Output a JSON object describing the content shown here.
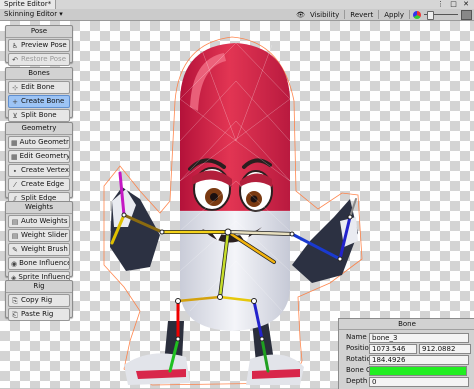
{
  "window": {
    "title": "Sprite Editor*",
    "controls": "⋮ □ ✕"
  },
  "toolbar": {
    "mode": "Skinning Editor ▾",
    "visibility": "Visibility",
    "revert": "Revert",
    "apply": "Apply"
  },
  "panels": {
    "pose": {
      "title": "Pose",
      "items": [
        {
          "label": "Preview Pose",
          "icon": "♿"
        },
        {
          "label": "Restore Pose",
          "icon": "↶"
        }
      ]
    },
    "bones": {
      "title": "Bones",
      "items": [
        {
          "label": "Edit Bone",
          "icon": "⊹"
        },
        {
          "label": "Create Bone",
          "icon": "+"
        },
        {
          "label": "Split Bone",
          "icon": "⊻"
        }
      ]
    },
    "geometry": {
      "title": "Geometry",
      "items": [
        {
          "label": "Auto Geometry",
          "icon": "▦"
        },
        {
          "label": "Edit Geometry",
          "icon": "▦"
        },
        {
          "label": "Create Vertex",
          "icon": "∙"
        },
        {
          "label": "Create Edge",
          "icon": "⁄"
        },
        {
          "label": "Split Edge",
          "icon": "⫽"
        }
      ]
    },
    "weights": {
      "title": "Weights",
      "items": [
        {
          "label": "Auto Weights",
          "icon": "▤"
        },
        {
          "label": "Weight Slider",
          "icon": "▤"
        },
        {
          "label": "Weight Brush",
          "icon": "✎"
        },
        {
          "label": "Bone Influence",
          "icon": "◉"
        },
        {
          "label": "Sprite Influence",
          "icon": "◈"
        }
      ]
    },
    "rig": {
      "title": "Rig",
      "items": [
        {
          "label": "Copy Rig",
          "icon": "⎘"
        },
        {
          "label": "Paste Rig",
          "icon": "⎗"
        }
      ]
    }
  },
  "bone_panel": {
    "title": "Bone",
    "name_label": "Name",
    "name_value": "bone_3",
    "position_label": "Position",
    "position_x": "1073.546",
    "position_y": "912.0882",
    "rotation_label": "Rotation",
    "rotation_value": "184.4926",
    "color_label": "Bone Color",
    "color_value": "#22ee22",
    "depth_label": "Depth",
    "depth_value": "0"
  },
  "colors": {
    "accent": "#9dc4f5",
    "capsule_red": "#d81c46",
    "capsule_white": "#eef0f4",
    "bone_outline": "#ff7a3c"
  }
}
